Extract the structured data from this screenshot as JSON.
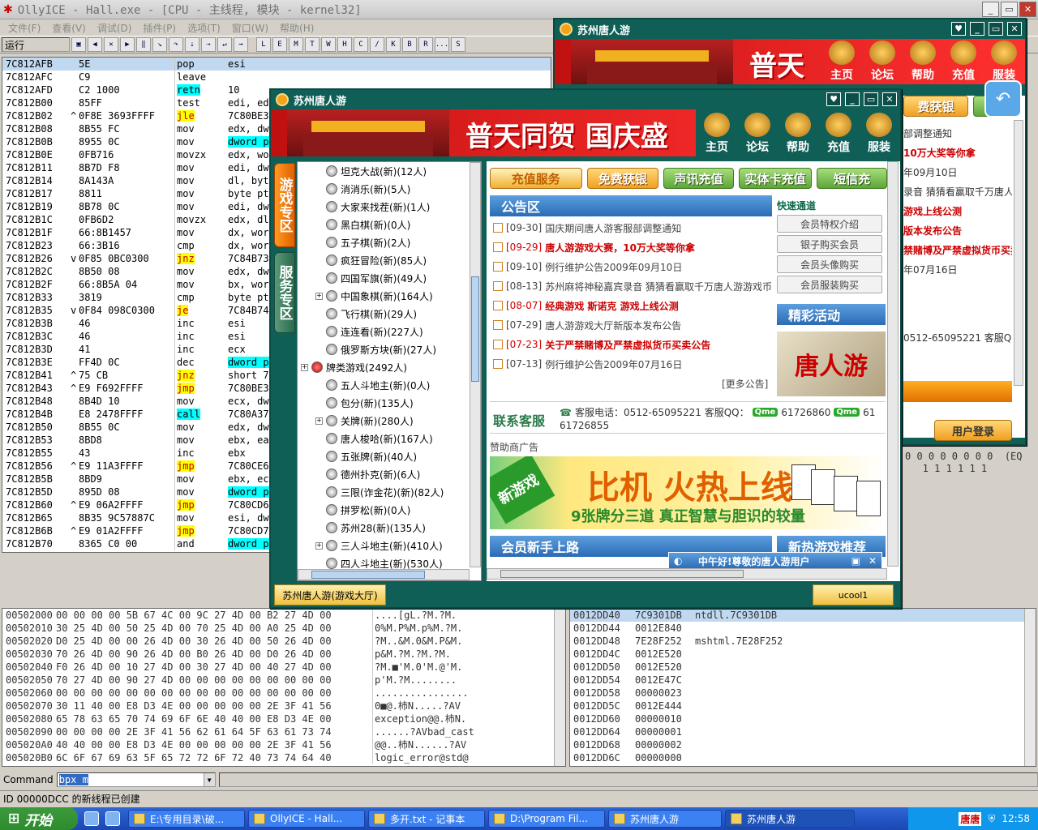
{
  "olly": {
    "title": "OllyICE - Hall.exe - [CPU -  主线程, 模块 - kernel32]",
    "menu": [
      "文件(F)",
      "查看(V)",
      "调试(D)",
      "插件(P)",
      "选项(T)",
      "窗口(W)",
      "帮助(H)"
    ],
    "status_label": "运行",
    "toolbar_letters": [
      "L",
      "E",
      "M",
      "T",
      "W",
      "H",
      "C",
      "/",
      "K",
      "B",
      "R",
      "...",
      "S"
    ],
    "disasm": [
      {
        "addr": "7C812AFB",
        "mark": "",
        "hex": "5E",
        "mn": "pop",
        "op": "esi",
        "cls": "",
        "sel": true
      },
      {
        "addr": "7C812AFC",
        "mark": "",
        "hex": "C9",
        "mn": "leave",
        "op": "",
        "cls": ""
      },
      {
        "addr": "7C812AFD",
        "mark": "",
        "hex": "C2 1000",
        "mn": "retn",
        "op": "10",
        "cls": "ret"
      },
      {
        "addr": "7C812B00",
        "mark": "",
        "hex": "85FF",
        "mn": "test",
        "op": "edi, edi",
        "cls": ""
      },
      {
        "addr": "7C812B02",
        "mark": "^",
        "hex": "0F8E 3693FFFF",
        "mn": "jle",
        "op": "7C80BE3",
        "cls": "jump"
      },
      {
        "addr": "7C812B08",
        "mark": "",
        "hex": "8B55 FC",
        "mn": "mov",
        "op": "edx, dw",
        "cls": ""
      },
      {
        "addr": "7C812B0B",
        "mark": "",
        "hex": "8955 0C",
        "mn": "mov",
        "op": "dword p",
        "cls": "",
        "ophl": true
      },
      {
        "addr": "7C812B0E",
        "mark": "",
        "hex": "0FB716",
        "mn": "movzx",
        "op": "edx, wo",
        "cls": ""
      },
      {
        "addr": "7C812B11",
        "mark": "",
        "hex": "8B7D F8",
        "mn": "mov",
        "op": "edi, dw",
        "cls": ""
      },
      {
        "addr": "7C812B14",
        "mark": "",
        "hex": "8A143A",
        "mn": "mov",
        "op": "dl, byt",
        "cls": ""
      },
      {
        "addr": "7C812B17",
        "mark": "",
        "hex": "8811",
        "mn": "mov",
        "op": "byte pt",
        "cls": ""
      },
      {
        "addr": "7C812B19",
        "mark": "",
        "hex": "8B78 0C",
        "mn": "mov",
        "op": "edi, dw",
        "cls": ""
      },
      {
        "addr": "7C812B1C",
        "mark": "",
        "hex": "0FB6D2",
        "mn": "movzx",
        "op": "edx, dl",
        "cls": ""
      },
      {
        "addr": "7C812B1F",
        "mark": "",
        "hex": "66:8B1457",
        "mn": "mov",
        "op": "dx, wor",
        "cls": ""
      },
      {
        "addr": "7C812B23",
        "mark": "",
        "hex": "66:3B16",
        "mn": "cmp",
        "op": "dx, wor",
        "cls": ""
      },
      {
        "addr": "7C812B26",
        "mark": "v",
        "hex": "0F85 0BC0300",
        "mn": "jnz",
        "op": "7C84B73",
        "cls": "jump"
      },
      {
        "addr": "7C812B2C",
        "mark": "",
        "hex": "8B50 08",
        "mn": "mov",
        "op": "edx, dw",
        "cls": ""
      },
      {
        "addr": "7C812B2F",
        "mark": "",
        "hex": "66:8B5A 04",
        "mn": "mov",
        "op": "bx, wor",
        "cls": ""
      },
      {
        "addr": "7C812B33",
        "mark": "",
        "hex": "3819",
        "mn": "cmp",
        "op": "byte pt",
        "cls": ""
      },
      {
        "addr": "7C812B35",
        "mark": "v",
        "hex": "0F84 098C0300",
        "mn": "je",
        "op": "7C84B74",
        "cls": "jump"
      },
      {
        "addr": "7C812B3B",
        "mark": "",
        "hex": "46",
        "mn": "inc",
        "op": "esi",
        "cls": ""
      },
      {
        "addr": "7C812B3C",
        "mark": "",
        "hex": "46",
        "mn": "inc",
        "op": "esi",
        "cls": ""
      },
      {
        "addr": "7C812B3D",
        "mark": "",
        "hex": "41",
        "mn": "inc",
        "op": "ecx",
        "cls": ""
      },
      {
        "addr": "7C812B3E",
        "mark": "",
        "hex": "FF4D 0C",
        "mn": "dec",
        "op": "dword p",
        "cls": "",
        "ophl": true
      },
      {
        "addr": "7C812B41",
        "mark": "^",
        "hex": "75 CB",
        "mn": "jnz",
        "op": "short 7",
        "cls": "jump"
      },
      {
        "addr": "7C812B43",
        "mark": "^",
        "hex": "E9 F692FFFF",
        "mn": "jmp",
        "op": "7C80BE3",
        "cls": "jump"
      },
      {
        "addr": "7C812B48",
        "mark": "",
        "hex": "8B4D 10",
        "mn": "mov",
        "op": "ecx, dw",
        "cls": ""
      },
      {
        "addr": "7C812B4B",
        "mark": "",
        "hex": "E8 2478FFFF",
        "mn": "call",
        "op": "7C80A37",
        "cls": "call"
      },
      {
        "addr": "7C812B50",
        "mark": "",
        "hex": "8B55 0C",
        "mn": "mov",
        "op": "edx, dw",
        "cls": ""
      },
      {
        "addr": "7C812B53",
        "mark": "",
        "hex": "8BD8",
        "mn": "mov",
        "op": "ebx, ea",
        "cls": ""
      },
      {
        "addr": "7C812B55",
        "mark": "",
        "hex": "43",
        "mn": "inc",
        "op": "ebx",
        "cls": ""
      },
      {
        "addr": "7C812B56",
        "mark": "^",
        "hex": "E9 11A3FFFF",
        "mn": "jmp",
        "op": "7C80CE6",
        "cls": "jump"
      },
      {
        "addr": "7C812B5B",
        "mark": "",
        "hex": "8BD9",
        "mn": "mov",
        "op": "ebx, ec",
        "cls": ""
      },
      {
        "addr": "7C812B5D",
        "mark": "",
        "hex": "895D 08",
        "mn": "mov",
        "op": "dword p",
        "cls": "",
        "ophl": true
      },
      {
        "addr": "7C812B60",
        "mark": "^",
        "hex": "E9 06A2FFFF",
        "mn": "jmp",
        "op": "7C80CD6",
        "cls": "jump"
      },
      {
        "addr": "7C812B65",
        "mark": "",
        "hex": "8B35 9C57887C",
        "mn": "mov",
        "op": "esi, dw",
        "cls": ""
      },
      {
        "addr": "7C812B6B",
        "mark": "^",
        "hex": "E9 01A2FFFF",
        "mn": "jmp",
        "op": "7C80CD7",
        "cls": "jump"
      },
      {
        "addr": "7C812B70",
        "mark": "",
        "hex": "8365 C0 00",
        "mn": "and",
        "op": "dword p",
        "cls": "",
        "ophl": true
      }
    ],
    "dump": [
      {
        "addr": "00502000",
        "hex": "00 00 00 00 5B 67 4C 00 9C 27 4D 00 B2 27 4D 00",
        "asc": "....[gL.?M.?M."
      },
      {
        "addr": "00502010",
        "hex": "30 25 4D 00 50 25 4D 00 70 25 4D 00 A0 25 4D 00",
        "asc": "0%M.P%M.p%M.?M."
      },
      {
        "addr": "00502020",
        "hex": "D0 25 4D 00 00 26 4D 00 30 26 4D 00 50 26 4D 00",
        "asc": "?M..&M.0&M.P&M."
      },
      {
        "addr": "00502030",
        "hex": "70 26 4D 00 90 26 4D 00 B0 26 4D 00 D0 26 4D 00",
        "asc": "p&M.?M.?M.?M."
      },
      {
        "addr": "00502040",
        "hex": "F0 26 4D 00 10 27 4D 00 30 27 4D 00 40 27 4D 00",
        "asc": "?M.■'M.0'M.@'M."
      },
      {
        "addr": "00502050",
        "hex": "70 27 4D 00 90 27 4D 00 00 00 00 00 00 00 00 00",
        "asc": "p'M.?M........"
      },
      {
        "addr": "00502060",
        "hex": "00 00 00 00 00 00 00 00 00 00 00 00 00 00 00 00",
        "asc": "................"
      },
      {
        "addr": "00502070",
        "hex": "30 11 40 00 E8 D3 4E 00 00 00 00 00 2E 3F 41 56",
        "asc": "0■@.杮N.....?AV"
      },
      {
        "addr": "00502080",
        "hex": "65 78 63 65 70 74 69 6F 6E 40 40 00 E8 D3 4E 00",
        "asc": "exception@@.杮N."
      },
      {
        "addr": "00502090",
        "hex": "00 00 00 00 2E 3F 41 56 62 61 64 5F 63 61 73 74",
        "asc": "......?AVbad_cast"
      },
      {
        "addr": "005020A0",
        "hex": "40 40 00 00 E8 D3 4E 00 00 00 00 00 2E 3F 41 56",
        "asc": "@@..杮N......?AV"
      },
      {
        "addr": "005020B0",
        "hex": "6C 6F 67 69 63 5F 65 72 72 6F 72 40 73 74 64 40",
        "asc": "logic_error@std@"
      }
    ],
    "stack": [
      {
        "addr": "0012DD40",
        "val": "7C9301DB",
        "cmt": "ntdll.7C9301DB"
      },
      {
        "addr": "0012DD44",
        "val": "0012E840",
        "cmt": ""
      },
      {
        "addr": "0012DD48",
        "val": "7E28F252",
        "cmt": "mshtml.7E28F252"
      },
      {
        "addr": "0012DD4C",
        "val": "0012E520",
        "cmt": ""
      },
      {
        "addr": "0012DD50",
        "val": "0012E520",
        "cmt": ""
      },
      {
        "addr": "0012DD54",
        "val": "0012E47C",
        "cmt": ""
      },
      {
        "addr": "0012DD58",
        "val": "00000023",
        "cmt": ""
      },
      {
        "addr": "0012DD5C",
        "val": "0012E444",
        "cmt": ""
      },
      {
        "addr": "0012DD60",
        "val": "00000010",
        "cmt": ""
      },
      {
        "addr": "0012DD64",
        "val": "00000001",
        "cmt": ""
      },
      {
        "addr": "0012DD68",
        "val": "00000002",
        "cmt": ""
      },
      {
        "addr": "0012DD6C",
        "val": "00000000",
        "cmt": ""
      }
    ],
    "stack_extra": "0 0 0 0 0 0 0 0  (EQ\n   1 1 1 1 1 1",
    "command_label": "Command",
    "command_value": "bpx m",
    "status_text": "ID 00000DCC 的新线程已创建"
  },
  "game_back": {
    "title": "苏州唐人游",
    "banner_text": "普天",
    "nav": [
      "主页",
      "论坛",
      "帮助",
      "充值",
      "服装"
    ],
    "free_btn": "费获银",
    "notices": [
      "部调整通知",
      "10万大奖等你拿",
      "年09月10日",
      "录音  猜猜看赢取千万唐人",
      "游戏上线公测",
      "版本发布公告",
      "禁赌博及严禁虚拟货币买卖公告",
      "年07月16日"
    ],
    "contact": "0512-65095221 客服Q",
    "login": "用户登录"
  },
  "game_front": {
    "title": "苏州唐人游",
    "banner_text": "普天同贺 国庆盛",
    "nav": [
      "主页",
      "论坛",
      "帮助",
      "充值",
      "服装"
    ],
    "tabs": [
      "游戏专区",
      "服务专区"
    ],
    "tree": [
      {
        "label": "坦克大战(新)(12人)",
        "exp": false
      },
      {
        "label": "消消乐(新)(5人)",
        "exp": false
      },
      {
        "label": "大家来找茬(新)(1人)",
        "exp": false
      },
      {
        "label": "黑白棋(新)(0人)",
        "exp": false
      },
      {
        "label": "五子棋(新)(2人)",
        "exp": false
      },
      {
        "label": "疯狂冒险(新)(85人)",
        "exp": false
      },
      {
        "label": "四国军旗(新)(49人)",
        "exp": false
      },
      {
        "label": "中国象棋(新)(164人)",
        "exp": true
      },
      {
        "label": "飞行棋(新)(29人)",
        "exp": false
      },
      {
        "label": "连连看(新)(227人)",
        "exp": false
      },
      {
        "label": "俄罗斯方块(新)(27人)",
        "exp": false
      },
      {
        "label": "牌类游戏(2492人)",
        "exp": true,
        "root": true
      },
      {
        "label": "五人斗地主(新)(0人)",
        "exp": false
      },
      {
        "label": "包分(新)(135人)",
        "exp": false
      },
      {
        "label": "关牌(新)(280人)",
        "exp": true
      },
      {
        "label": "唐人梭哈(新)(167人)",
        "exp": false
      },
      {
        "label": "五张牌(新)(40人)",
        "exp": false
      },
      {
        "label": "德州扑克(新)(6人)",
        "exp": false
      },
      {
        "label": "三限(诈金花)(新)(82人)",
        "exp": false
      },
      {
        "label": "拼罗松(新)(0人)",
        "exp": false
      },
      {
        "label": "苏州28(新)(135人)",
        "exp": false
      },
      {
        "label": "三人斗地主(新)(410人)",
        "exp": true
      },
      {
        "label": "四人斗地主(新)(530人)",
        "exp": false
      }
    ],
    "top_buttons": [
      "充值服务",
      "免费获银",
      "声讯充值",
      "实体卡充值",
      "短信充"
    ],
    "notice_title": "公告区",
    "notices": [
      {
        "date": "[09-30]",
        "text": "国庆期间唐人游客服部调整通知",
        "red": false
      },
      {
        "date": "[09-29]",
        "text": "唐人游游戏大赛，10万大奖等你拿",
        "red": true
      },
      {
        "date": "[09-10]",
        "text": "例行维护公告2009年09月10日",
        "red": false
      },
      {
        "date": "[08-13]",
        "text": "苏州麻将神秘嘉宾录音  猜猜看赢取千万唐人游游戏币",
        "red": false
      },
      {
        "date": "[08-07]",
        "text": "经典游戏  斯诺克  游戏上线公测",
        "red": true
      },
      {
        "date": "[07-29]",
        "text": "唐人游游戏大厅新版本发布公告",
        "red": false
      },
      {
        "date": "[07-23]",
        "text": "关于严禁赌博及严禁虚拟货币买卖公告",
        "red": true
      },
      {
        "date": "[07-13]",
        "text": "例行维护公告2009年07月16日",
        "red": false
      }
    ],
    "more": "[更多公告]",
    "quick_title": "快速通道",
    "quick": [
      "会员特权介绍",
      "银子购买会员",
      "会员头像购买",
      "会员服装购买"
    ],
    "activity_title": "精彩活动",
    "activity_img_text": "唐人游",
    "contact_title": "联系客服",
    "contact_text": "客服电话：0512-65095221 客服QQ：",
    "qq1": "61726860",
    "qq_tail": "61",
    "qq2": "61726855",
    "qme": "Qme",
    "sponsor": "赞助商广告",
    "ad_new": "新游戏",
    "ad_main": "比机  火热上线",
    "ad_sub": "9张牌分三道  真正智慧与胆识的较量",
    "newbie_title": "会员新手上路",
    "hot_title": "新热游戏推荐",
    "popup": "中午好!尊敬的唐人游用户",
    "footer_tab": "苏州唐人游(游戏大厅)",
    "footer_user": "ucool1"
  },
  "taskbar": {
    "start": "开始",
    "tasks": [
      "E:\\专用目录\\破...",
      "OllyICE - Hall...",
      "多开.txt - 记事本",
      "D:\\Program Fil...",
      "苏州唐人游",
      "苏州唐人游"
    ],
    "tray_text": "唐唐",
    "clock": "12:58"
  }
}
